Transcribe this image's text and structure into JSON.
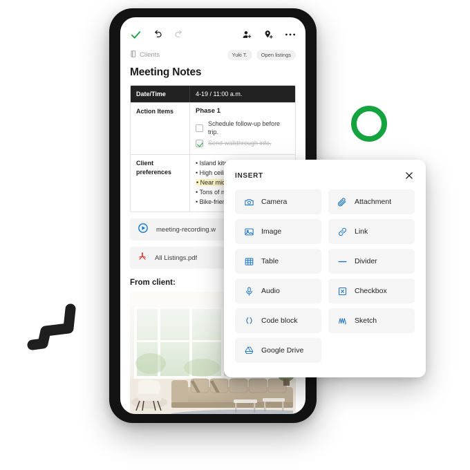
{
  "decor": {
    "green_ring_color": "#15a33f",
    "zigzag_color": "#1e1e1e"
  },
  "app": {
    "toolbar": {
      "done_icon": "green-check-icon",
      "undo_icon": "undo-arrow-icon",
      "redo_icon": "redo-arrow-icon",
      "add_person_icon": "add-person-icon",
      "add_location_icon": "add-location-pin-icon",
      "more_icon": "more-options-icon"
    },
    "breadcrumb": {
      "icon": "notebook-icon",
      "label": "Clients"
    },
    "chips": [
      {
        "label": "Yuki T."
      },
      {
        "label": "Open listings"
      }
    ],
    "title": "Meeting Notes"
  },
  "note_table": {
    "rows": [
      {
        "label": "Date/Time",
        "value": "4-19 / 11:00 a.m.",
        "type": "header"
      },
      {
        "label": "Action Items",
        "type": "tasks",
        "phase": "Phase 1",
        "tasks": [
          {
            "text": "Schedule follow-up before trip.",
            "checked": false
          },
          {
            "text": "Send walkthrough info.",
            "checked": true
          }
        ]
      },
      {
        "label": "Client preferences",
        "type": "list",
        "items": [
          {
            "text": "Island kitchen",
            "highlighted": false
          },
          {
            "text": "High ceilin",
            "highlighted": false
          },
          {
            "text": "Near midd",
            "highlighted": true
          },
          {
            "text": "Tons of na",
            "highlighted": false
          },
          {
            "text": "Bike-friend",
            "highlighted": false
          }
        ]
      }
    ]
  },
  "attachments": [
    {
      "name": "meeting-recording.w",
      "icon": "play-circle-icon"
    },
    {
      "name": "All Listings.pdf",
      "icon": "pdf-icon"
    }
  ],
  "from_client": {
    "heading": "From client:",
    "image_alt": "bright living room with large windows and beige sectional sofa"
  },
  "insert_panel": {
    "title": "INSERT",
    "close_icon": "close-icon",
    "items": [
      {
        "label": "Camera",
        "icon": "camera-icon"
      },
      {
        "label": "Attachment",
        "icon": "paperclip-icon"
      },
      {
        "label": "Image",
        "icon": "image-icon"
      },
      {
        "label": "Link",
        "icon": "link-icon"
      },
      {
        "label": "Table",
        "icon": "table-icon"
      },
      {
        "label": "Divider",
        "icon": "divider-icon"
      },
      {
        "label": "Audio",
        "icon": "microphone-icon"
      },
      {
        "label": "Checkbox",
        "icon": "checkbox-icon"
      },
      {
        "label": "Code block",
        "icon": "code-braces-icon"
      },
      {
        "label": "Sketch",
        "icon": "sketch-scribble-icon"
      },
      {
        "label": "Google Drive",
        "icon": "google-drive-icon"
      }
    ],
    "accent_color": "#1a73c4"
  }
}
